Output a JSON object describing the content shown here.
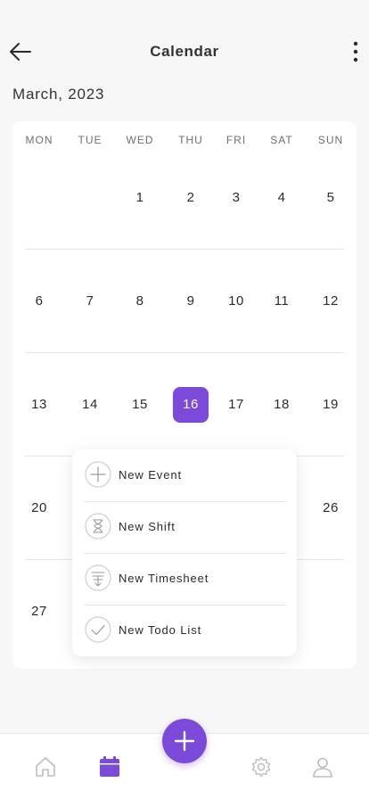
{
  "header": {
    "title": "Calendar",
    "back_icon": "arrow-left-icon",
    "menu_icon": "kebab-menu-icon"
  },
  "month_label": "March, 2023",
  "weekdays": [
    "MON",
    "TUE",
    "WED",
    "THU",
    "FRI",
    "SAT",
    "SUN"
  ],
  "weeks": [
    [
      "",
      "",
      "1",
      "2",
      "3",
      "4",
      "5"
    ],
    [
      "6",
      "7",
      "8",
      "9",
      "10",
      "11",
      "12"
    ],
    [
      "13",
      "14",
      "15",
      "16",
      "17",
      "18",
      "19"
    ],
    [
      "20",
      "",
      "",
      "",
      "",
      "",
      "26"
    ],
    [
      "27",
      "",
      "",
      "",
      "",
      "",
      ""
    ]
  ],
  "selected_day": "16",
  "popup_menu": {
    "items": [
      {
        "label": "New Event",
        "icon": "plus-circle-icon"
      },
      {
        "label": "New Shift",
        "icon": "hourglass-icon"
      },
      {
        "label": "New Timesheet",
        "icon": "timesheet-icon"
      },
      {
        "label": "New Todo List",
        "icon": "check-circle-icon"
      }
    ]
  },
  "bottom_nav": {
    "items": [
      "home-icon",
      "calendar-icon",
      "settings-icon",
      "profile-icon"
    ],
    "active": "calendar-icon",
    "fab_icon": "plus-icon"
  },
  "colors": {
    "accent": "#7c4ad8",
    "background": "#f7f7f7",
    "card": "#ffffff",
    "inactive_icon": "#bdbdbd"
  }
}
